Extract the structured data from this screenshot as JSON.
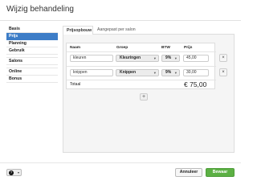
{
  "dialog": {
    "title": "Wijzig behandeling"
  },
  "sidebar": {
    "items": [
      {
        "label": "Basis",
        "active": false
      },
      {
        "label": "Prijs",
        "active": true
      },
      {
        "label": "Planning",
        "active": false
      },
      {
        "label": "Gebruik",
        "active": false
      },
      {
        "label": "Salons",
        "active": false
      },
      {
        "label": "Online",
        "active": false
      },
      {
        "label": "Bonus",
        "active": false
      }
    ]
  },
  "tabs": [
    {
      "label": "Prijsopbouw",
      "active": true
    },
    {
      "label": "Aangepast per salon",
      "active": false
    }
  ],
  "table": {
    "headers": {
      "naam": "Naam",
      "groep": "Groep",
      "btw": "BTW",
      "prijs": "Prijs"
    },
    "rows": [
      {
        "naam": "kleuren",
        "groep": "Kleuringen",
        "btw": "9%",
        "prijs": "45,00"
      },
      {
        "naam": "knippen",
        "groep": "Knippen",
        "btw": "9%",
        "prijs": "30,00"
      }
    ],
    "total_label": "Totaal",
    "total_value": "€ 75,00"
  },
  "icons": {
    "delete": "×",
    "add": "+",
    "caret": "▾",
    "help": "?"
  },
  "footer": {
    "cancel_label": "Annuleer",
    "save_label": "Bewaar"
  },
  "colors": {
    "accent": "#3d7dc7",
    "save": "#5cb044"
  }
}
